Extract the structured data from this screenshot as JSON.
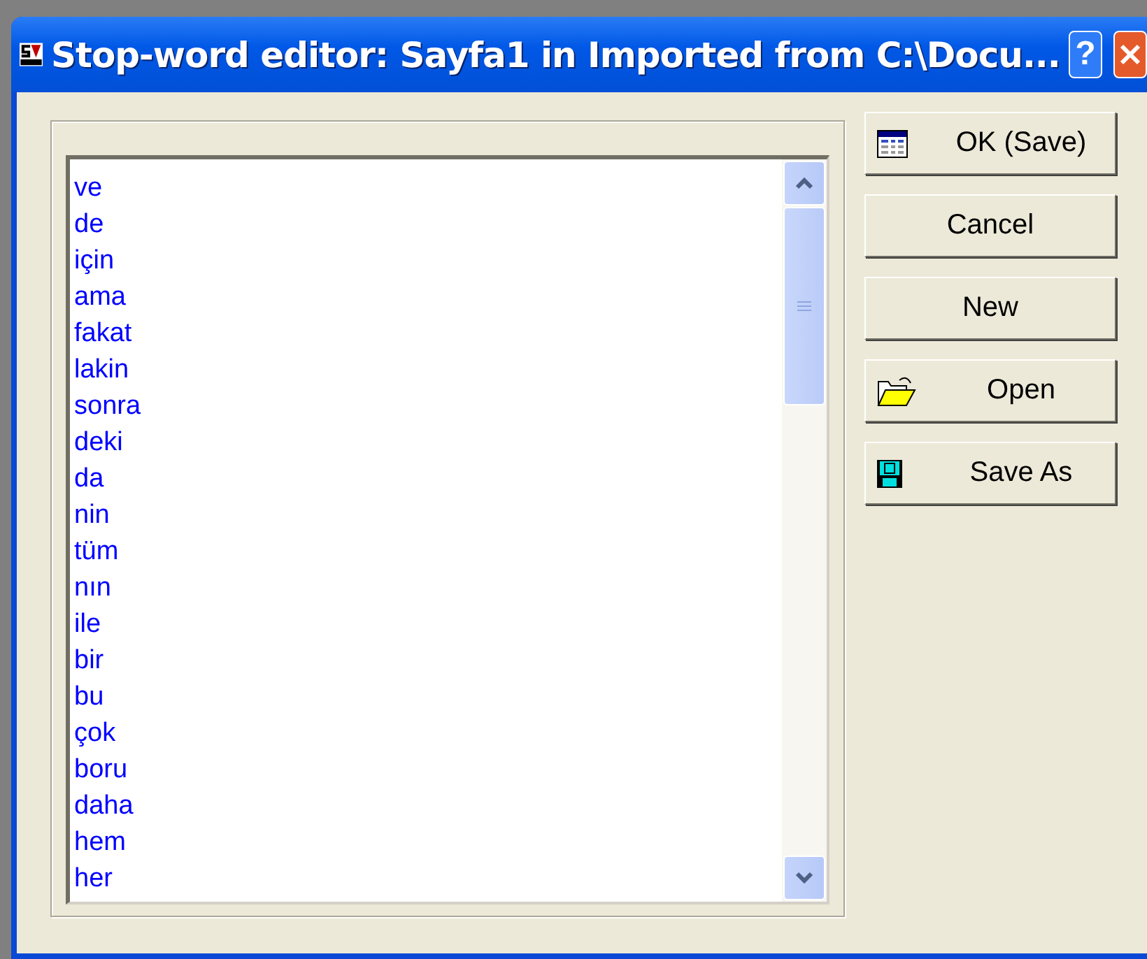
{
  "window": {
    "title": "Stop-word editor: Sayfa1 in Imported from C:\\Docu...",
    "help": "?"
  },
  "words": [
    "ve",
    "de",
    "için",
    "ama",
    "fakat",
    "lakin",
    "sonra",
    "deki",
    "da",
    "nin",
    "tüm",
    "nın",
    "ile",
    "bir",
    "bu",
    "çok",
    "boru",
    "daha",
    "hem",
    "her"
  ],
  "buttons": [
    {
      "label": "OK (Save)",
      "kind": "table"
    },
    {
      "label": "Cancel",
      "kind": "plain"
    },
    {
      "label": "New",
      "kind": "plain"
    },
    {
      "label": "Open",
      "kind": "folder"
    },
    {
      "label": "Save As",
      "kind": "disk"
    }
  ]
}
